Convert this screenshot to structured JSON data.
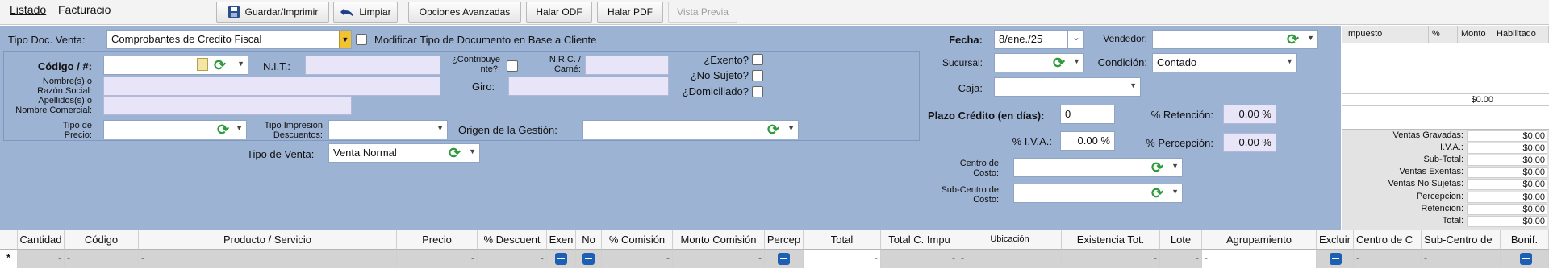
{
  "tabs": {
    "listado": "Listado",
    "facturacion": "Facturacio"
  },
  "toolbar": {
    "guardar": "Guardar/Imprimir",
    "limpiar": "Limpiar",
    "opciones": "Opciones Avanzadas",
    "halar_odf": "Halar ODF",
    "halar_pdf": "Halar PDF",
    "vista_previa": "Vista Previa"
  },
  "form": {
    "tipo_doc_label": "Tipo Doc. Venta:",
    "tipo_doc_value": "Comprobantes de Credito Fiscal",
    "modificar_label": "Modificar Tipo de Documento en Base a Cliente",
    "codigo_label": "Código / #:",
    "nit_label": "N.I.T.:",
    "contribuyente_label": "¿Contribuye\nnte?:",
    "nrc_label": "N.R.C. /\nCarné:",
    "exento_label": "¿Exento?",
    "no_sujeto_label": "¿No Sujeto?",
    "domiciliado_label": "¿Domiciliado?",
    "nombre_label": "Nombre(s) o\nRazón Social:",
    "giro_label": "Giro:",
    "apellidos_label": "Apellidos(s) o\nNombre Comercial:",
    "tipo_precio_label": "Tipo de\nPrecio:",
    "tipo_precio_value": "-",
    "tipo_impresion_label": "Tipo Impresion\nDescuentos:",
    "origen_label": "Origen de la Gestión:",
    "tipo_venta_label": "Tipo de Venta:",
    "tipo_venta_value": "Venta Normal",
    "fecha_label": "Fecha:",
    "fecha_value": "8/ene./25",
    "vendedor_label": "Vendedor:",
    "sucursal_label": "Sucursal:",
    "condicion_label": "Condición:",
    "condicion_value": "Contado",
    "caja_label": "Caja:",
    "plazo_label": "Plazo Crédito (en días):",
    "plazo_value": "0",
    "retencion_label": "% Retención:",
    "retencion_value": "0.00 %",
    "iva_label": "% I.V.A.:",
    "iva_value": "0.00 %",
    "percepcion_label": "% Percepción:",
    "percepcion_value": "0.00 %",
    "centro_costo_label": "Centro de\nCosto:",
    "sub_centro_label": "Sub-Centro de\nCosto:"
  },
  "impuestos": {
    "headers": [
      "Impuesto",
      "%",
      "Monto",
      "Habilitado"
    ],
    "total": "$0.00"
  },
  "totales": [
    {
      "label": "Ventas Gravadas:",
      "value": "$0.00"
    },
    {
      "label": "I.V.A.:",
      "value": "$0.00"
    },
    {
      "label": "Sub-Total:",
      "value": "$0.00"
    },
    {
      "label": "Ventas Exentas:",
      "value": "$0.00"
    },
    {
      "label": "Ventas No Sujetas:",
      "value": "$0.00"
    },
    {
      "label": "Percepcion:",
      "value": "$0.00"
    },
    {
      "label": "Retencion:",
      "value": "$0.00"
    },
    {
      "label": "Total:",
      "value": "$0.00"
    }
  ],
  "grid": {
    "columns": [
      "Cantidad",
      "Código",
      "Producto / Servicio",
      "Precio",
      "% Descuent",
      "Exen",
      "No",
      "% Comisión",
      "Monto Comisión",
      "Percep",
      "Total",
      "Total C. Impu",
      "Ubicación",
      "Existencia Tot.",
      "Lote",
      "Agrupamiento",
      "Excluir",
      "Centro de C",
      "Sub-Centro de",
      "Bonif."
    ],
    "row_marker": "*",
    "cells": [
      "-",
      "-",
      "-",
      "-",
      "-",
      "",
      "",
      "-",
      "-",
      "",
      "-",
      "-",
      "-",
      "-",
      "-",
      "-",
      "",
      "-",
      "-",
      ""
    ]
  }
}
